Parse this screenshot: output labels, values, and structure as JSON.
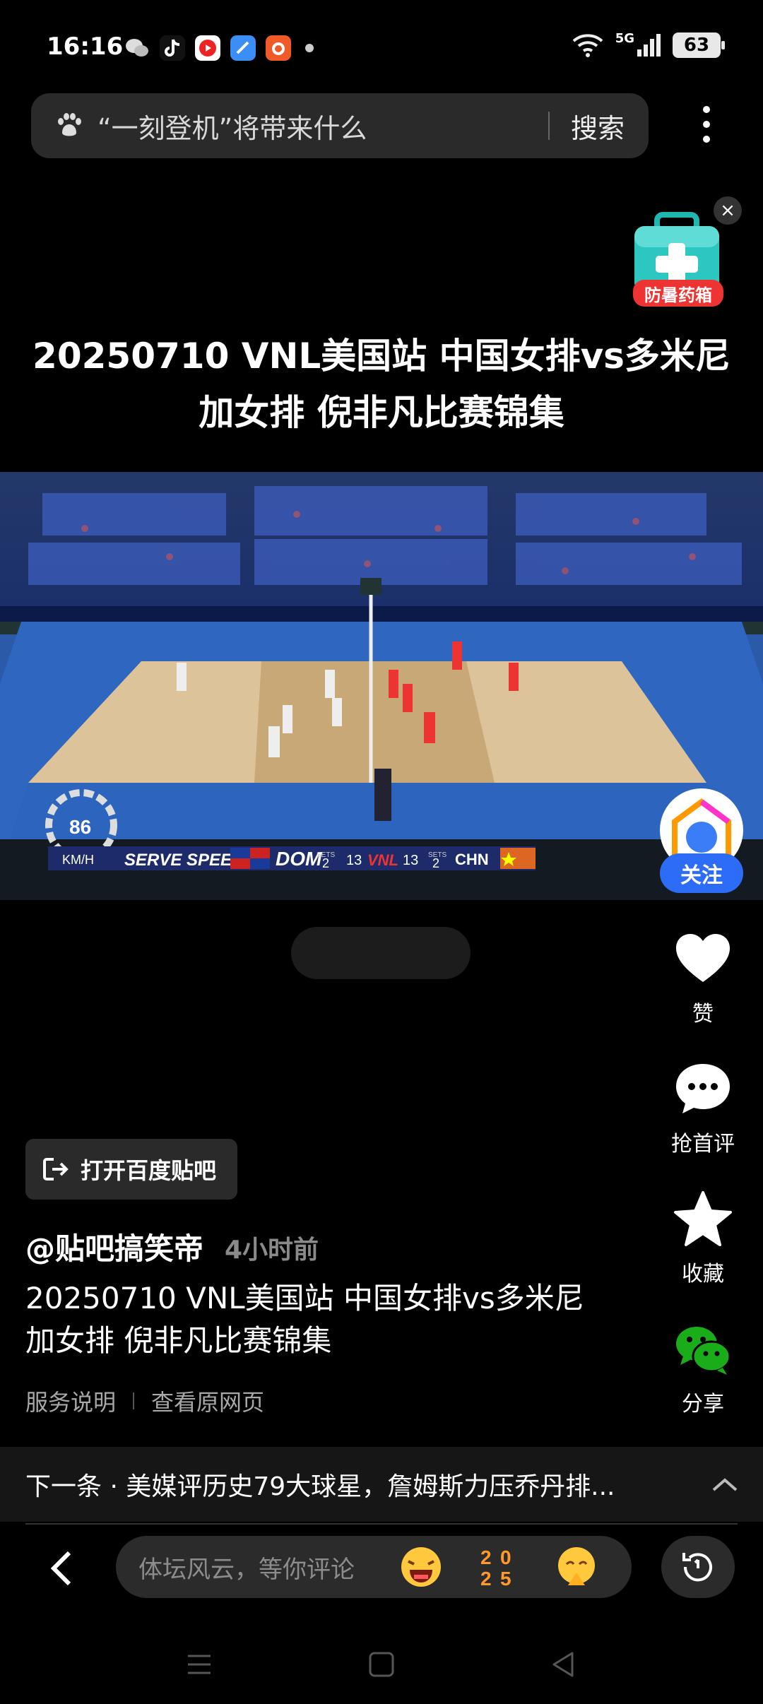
{
  "status_bar": {
    "time": "16:16",
    "network": "5G",
    "battery": "63"
  },
  "search": {
    "query": "“一刻登机”将带来什么",
    "button": "搜索"
  },
  "ad": {
    "label": "防暑药箱"
  },
  "video": {
    "title": "20250710 VNL美国站 中国女排vs多米尼加女排 倪非凡比赛锦集"
  },
  "follow": {
    "label": "关注"
  },
  "actions": {
    "like": "赞",
    "comment": "抢首评",
    "favorite": "收藏",
    "share": "分享"
  },
  "open_tieba": {
    "label": "打开百度贴吧"
  },
  "post": {
    "author": "@贴吧搞笑帝",
    "time_ago": "4小时前",
    "description": "20250710 VNL美国站 中国女排vs多米尼加女排 倪非凡比赛锦集",
    "service_link": "服务说明",
    "original_link": "查看原网页"
  },
  "next": {
    "text": "下一条 · 美媒评历史79大球星，詹姆斯力压乔丹排..."
  },
  "comment_bar": {
    "placeholder": "体坛风云，等你评论"
  },
  "scoreboard": {
    "serve_speed": "SERVE SPEED",
    "unit": "KM/H",
    "speed": "86",
    "team_a": "DOM",
    "sets_label": "SETS",
    "sets_a": "2",
    "score_a": "13",
    "score_b": "13",
    "sets_b": "2",
    "team_b": "CHN",
    "center": "VNL"
  }
}
